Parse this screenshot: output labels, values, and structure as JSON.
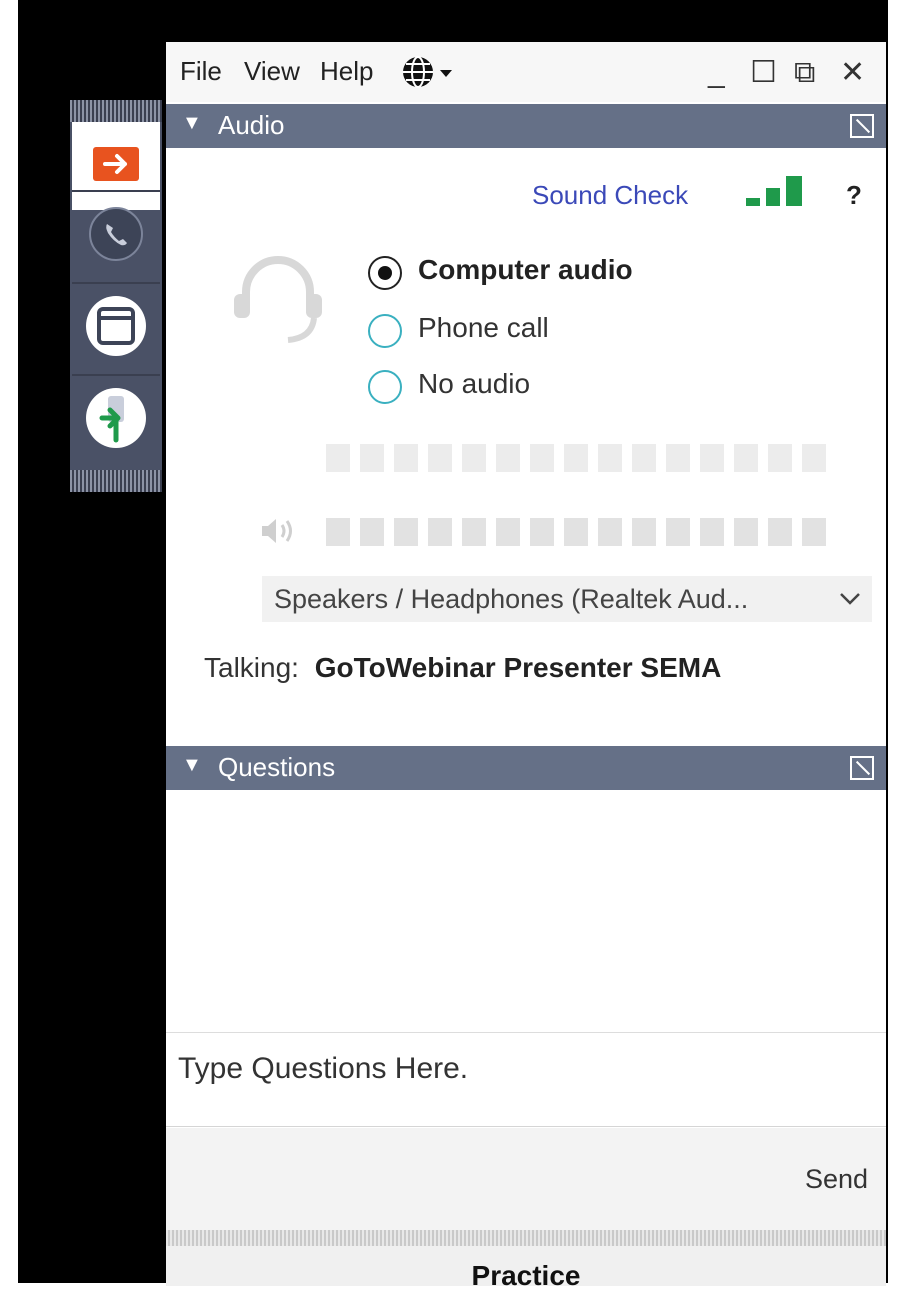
{
  "menu": {
    "file": "File",
    "view": "View",
    "help": "Help",
    "language_icon": "globe-icon"
  },
  "window_controls": {
    "minimize": "_",
    "maximize": "☐",
    "restore": "⧉",
    "close": "✕"
  },
  "toolbar": {
    "items": [
      "exit-arrow-icon",
      "phone-icon",
      "window-icon",
      "raise-hand-icon"
    ],
    "accent_color": "#e8531f",
    "hand_color": "#1f9a4b"
  },
  "audio": {
    "title": "Audio",
    "sound_check": "Sound Check",
    "help": "?",
    "signal_color": "#1f9a4b",
    "options": [
      {
        "label": "Computer audio",
        "selected": true
      },
      {
        "label": "Phone call",
        "selected": false
      },
      {
        "label": "No audio",
        "selected": false
      }
    ],
    "device": "Speakers / Headphones (Realtek Aud...",
    "talking_label": "Talking:",
    "talking_name": "GoToWebinar Presenter SEMA"
  },
  "questions": {
    "title": "Questions",
    "placeholder": "Type Questions Here.",
    "send": "Send"
  },
  "footer": {
    "practice": "Practice"
  }
}
